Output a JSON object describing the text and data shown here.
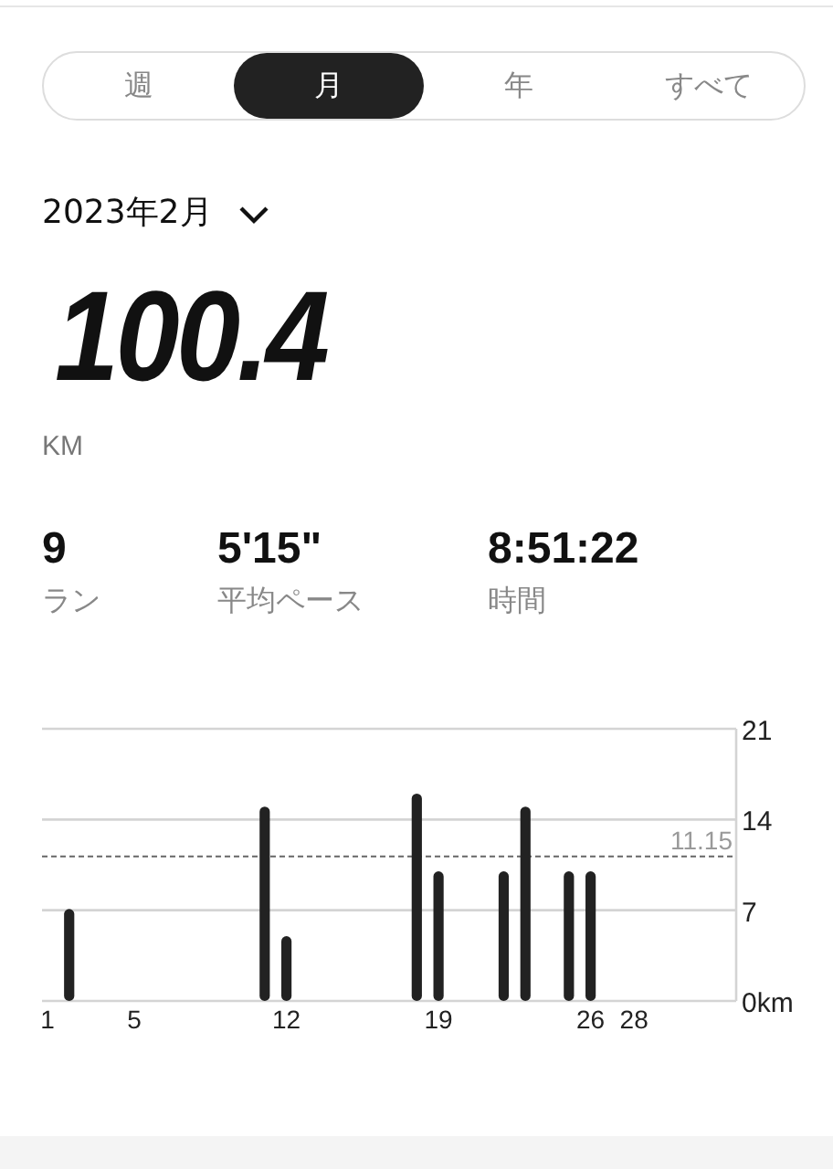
{
  "tabs": [
    {
      "label": "週",
      "selected": false
    },
    {
      "label": "月",
      "selected": true
    },
    {
      "label": "年",
      "selected": false
    },
    {
      "label": "すべて",
      "selected": false
    }
  ],
  "period": {
    "label": "2023年2月"
  },
  "total": {
    "value": "100.4",
    "unit": "KM"
  },
  "stats": [
    {
      "value": "9",
      "label": "ラン"
    },
    {
      "value": "5'15\"",
      "label": "平均ペース"
    },
    {
      "value": "8:51:22",
      "label": "時間"
    }
  ],
  "chart": {
    "chart_data": {
      "type": "bar",
      "x": [
        2,
        11,
        12,
        18,
        19,
        22,
        23,
        25,
        26
      ],
      "series": [
        {
          "color": "#222222",
          "values": [
            7.1,
            15.0,
            5.0,
            16.0,
            10.0,
            10.0,
            15.0,
            10.0,
            10.0
          ]
        }
      ],
      "xticks": [
        1,
        5,
        12,
        19,
        26,
        28
      ],
      "xlim": [
        0.75,
        32.7
      ],
      "yticks": [
        {
          "value": 0,
          "label": "0km"
        },
        7,
        14,
        21
      ],
      "ylim": [
        0,
        21
      ],
      "ref_lines": [
        {
          "axis": "y",
          "value": 11.15,
          "label": "11.15"
        }
      ]
    }
  }
}
